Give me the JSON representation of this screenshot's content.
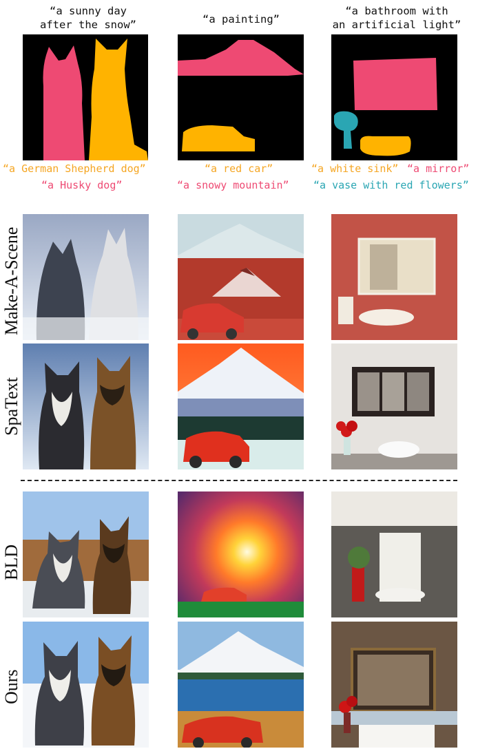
{
  "prompts": {
    "col1": "“a sunny day\nafter the snow”",
    "col2": "“a painting”",
    "col3": "“a bathroom with\nan artificial light”"
  },
  "mask_labels": {
    "col1": [
      {
        "text": "“a German Shepherd dog”",
        "color": "#f5a623"
      },
      {
        "text": "“a Husky dog”",
        "color": "#ee4a73"
      }
    ],
    "col2": [
      {
        "text": "“a red car”",
        "color": "#f5a623"
      },
      {
        "text": "“a snowy mountain”",
        "color": "#ee4a73"
      }
    ],
    "col3": [
      {
        "text": "“a white sink”",
        "color": "#f5a623"
      },
      {
        "text": "“a mirror”",
        "color": "#ee4a73"
      },
      {
        "text": "“a vase with red flowers”",
        "color": "#2aa6b3"
      }
    ]
  },
  "row_labels": [
    "Make-A-Scene",
    "SpaText",
    "BLD",
    "Ours"
  ],
  "mask_colors": {
    "pink": "#ee4a73",
    "yellow": "#ffb300",
    "teal": "#2aa6b3"
  }
}
